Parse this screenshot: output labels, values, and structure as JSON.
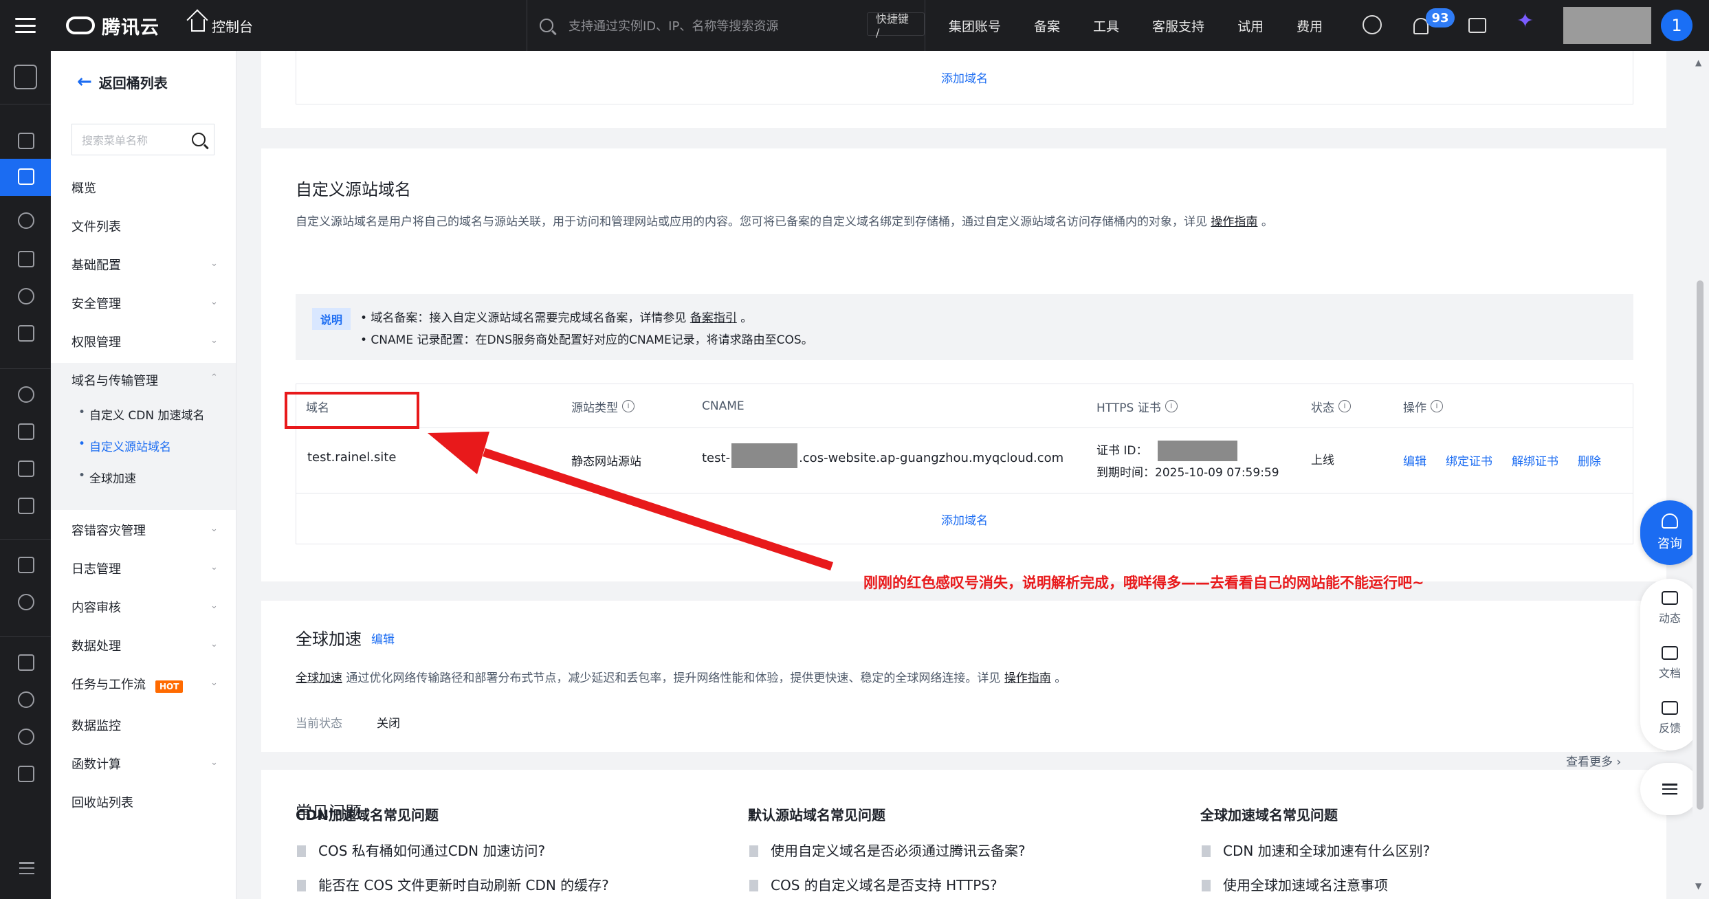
{
  "topbar": {
    "brand": "腾讯云",
    "console": "控制台",
    "search_placeholder": "支持通过实例ID、IP、名称等搜索资源",
    "shortcut": "快捷键 /",
    "links": [
      "集团账号",
      "备案",
      "工具",
      "客服支持",
      "试用",
      "费用"
    ],
    "notification_count": "93",
    "avatar_initial": "1",
    "icons": [
      "menu-icon",
      "cloud-logo-icon",
      "home-icon",
      "search-icon",
      "face-icon",
      "bell-icon",
      "card-icon",
      "sparkle-icon"
    ]
  },
  "sidemenu": {
    "back_label": "返回桶列表",
    "search_placeholder": "搜索菜单名称",
    "items": [
      {
        "label": "概览"
      },
      {
        "label": "文件列表"
      },
      {
        "label": "基础配置"
      },
      {
        "label": "安全管理"
      },
      {
        "label": "权限管理"
      },
      {
        "label": "域名与传输管理"
      },
      {
        "label": "容错容灾管理"
      },
      {
        "label": "日志管理"
      },
      {
        "label": "内容审核"
      },
      {
        "label": "数据处理"
      },
      {
        "label": "任务与工作流"
      },
      {
        "label": "数据监控"
      },
      {
        "label": "函数计算"
      },
      {
        "label": "回收站列表"
      }
    ],
    "sub_items": [
      "自定义 CDN 加速域名",
      "自定义源站域名",
      "全球加速"
    ],
    "hot_badge": "HOT"
  },
  "main": {
    "top_add_domain": "添加域名",
    "origin_section": {
      "title": "自定义源站域名",
      "desc_prefix": "自定义源站域名是用户将自己的域名与源站关联，用于访问和管理网站或应用的内容。您可将已备案的自定义域名绑定到存储桶，通过自定义源站域名访问存储桶内的对象，详见",
      "desc_link": "操作指南",
      "desc_suffix": "。",
      "note_tag": "说明",
      "note_line1_prefix": "• 域名备案：接入自定义源站域名需要完成域名备案，详情参见",
      "note_line1_link": "备案指引",
      "note_line1_suffix": "。",
      "note_line2": "• CNAME 记录配置：在DNS服务商处配置好对应的CNAME记录，将请求路由至COS。",
      "columns": [
        "域名",
        "源站类型",
        "CNAME",
        "HTTPS 证书",
        "状态",
        "操作"
      ],
      "row": {
        "domain": "test.rainel.site",
        "origin_type": "静态网站源站",
        "cname_prefix": "test-",
        "cname_suffix": ".cos-website.ap-guangzhou.myqcloud.com",
        "cert_id_label": "证书 ID：",
        "expire_label": "到期时间：",
        "expire_value": "2025-10-09 07:59:59",
        "status": "上线",
        "actions": [
          "编辑",
          "绑定证书",
          "解绑证书",
          "删除"
        ]
      },
      "add_domain": "添加域名"
    },
    "annotation": "刚刚的红色感叹号消失，说明解析完成，哦咩得多——去看看自己的网站能不能运行吧~",
    "global_section": {
      "title": "全球加速",
      "edit": "编辑",
      "desc_link": "全球加速",
      "desc_body": "通过优化网络传输路径和部署分布式节点，减少延迟和丢包率，提升网络性能和体验，提供更快速、稳定的全球网络连接。详见",
      "desc_link2": "操作指南",
      "desc_suffix": "。",
      "status_label": "当前状态",
      "status_value": "关闭"
    },
    "faq": {
      "title": "常见问题",
      "more": "查看更多 ›",
      "columns": [
        {
          "title": "CDN加速域名常见问题",
          "items": [
            "COS 私有桶如何通过CDN 加速访问?",
            "能否在 COS 文件更新时自动刷新 CDN 的缓存?"
          ]
        },
        {
          "title": "默认源站域名常见问题",
          "items": [
            "使用自定义域名是否必须通过腾讯云备案?",
            "COS 的自定义域名是否支持 HTTPS?"
          ]
        },
        {
          "title": "全球加速域名常见问题",
          "items": [
            "CDN 加速和全球加速有什么区别?",
            "使用全球加速域名注意事项"
          ]
        }
      ]
    }
  },
  "float_tools": {
    "consult": "咨询",
    "items": [
      "动态",
      "文档",
      "反馈"
    ]
  },
  "colors": {
    "accent": "#1b6cf2",
    "topbar_bg": "#1d1e21",
    "annotation_red": "#e8191b",
    "hot_orange": "#ff6a00"
  }
}
